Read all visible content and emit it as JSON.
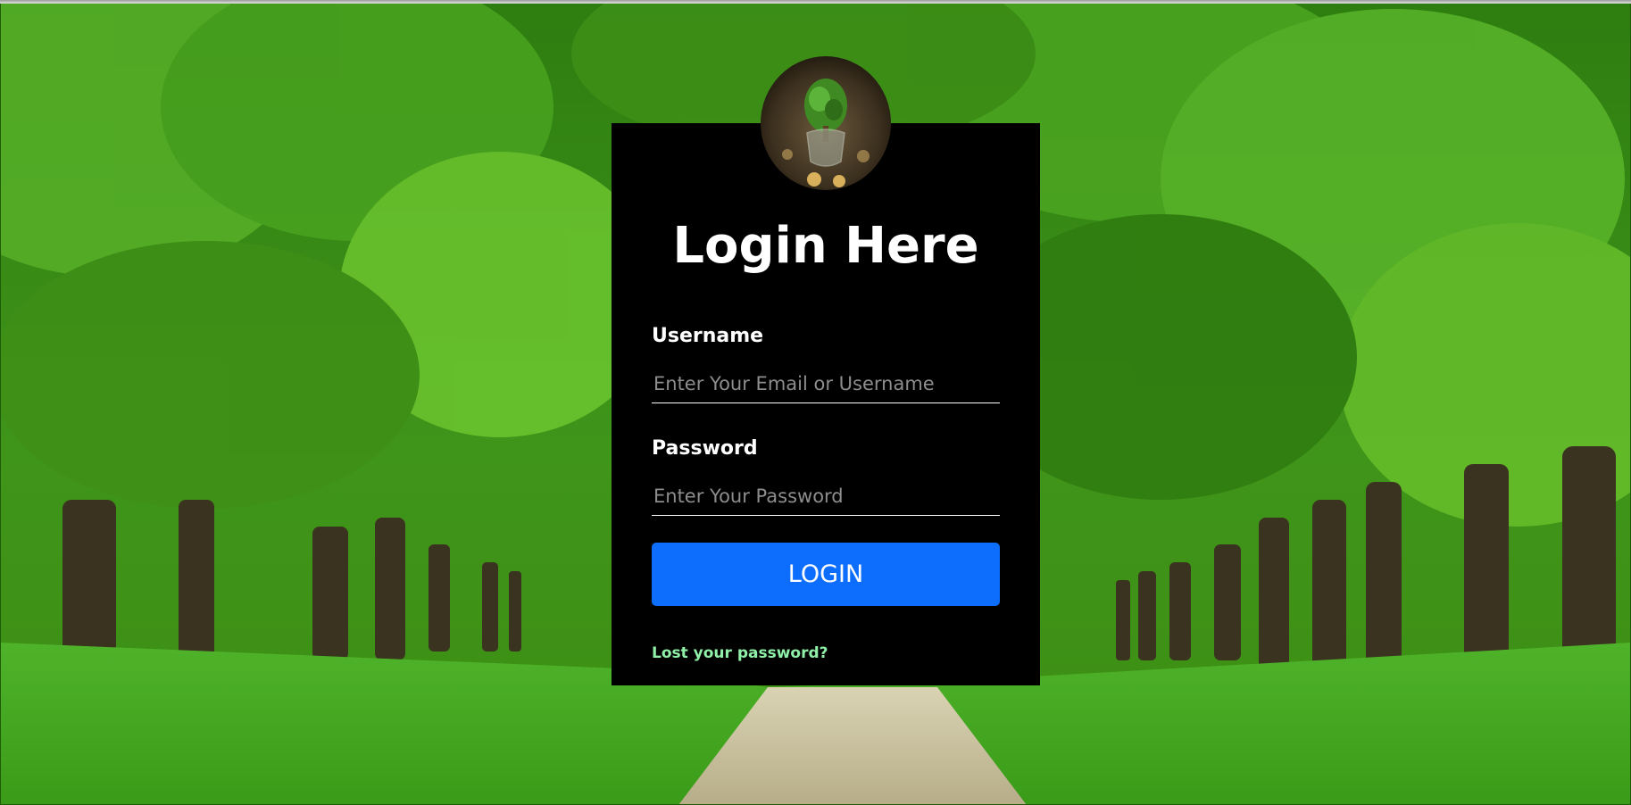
{
  "login_form": {
    "title": "Login Here",
    "username_label": "Username",
    "username_value": "",
    "username_placeholder": "Enter Your Email or Username",
    "password_label": "Password",
    "password_value": "",
    "password_placeholder": "Enter Your Password",
    "login_button_label": "LOGIN",
    "lost_password_link": "Lost your password?"
  },
  "colors": {
    "card_background": "#000000",
    "button_blue": "#0d6efd",
    "link_green": "#8ff0a8",
    "background_green": "#2f7a12"
  },
  "icons": {
    "avatar": "tree-in-glass-avatar-image",
    "background": "forest-avenue-background-image"
  }
}
